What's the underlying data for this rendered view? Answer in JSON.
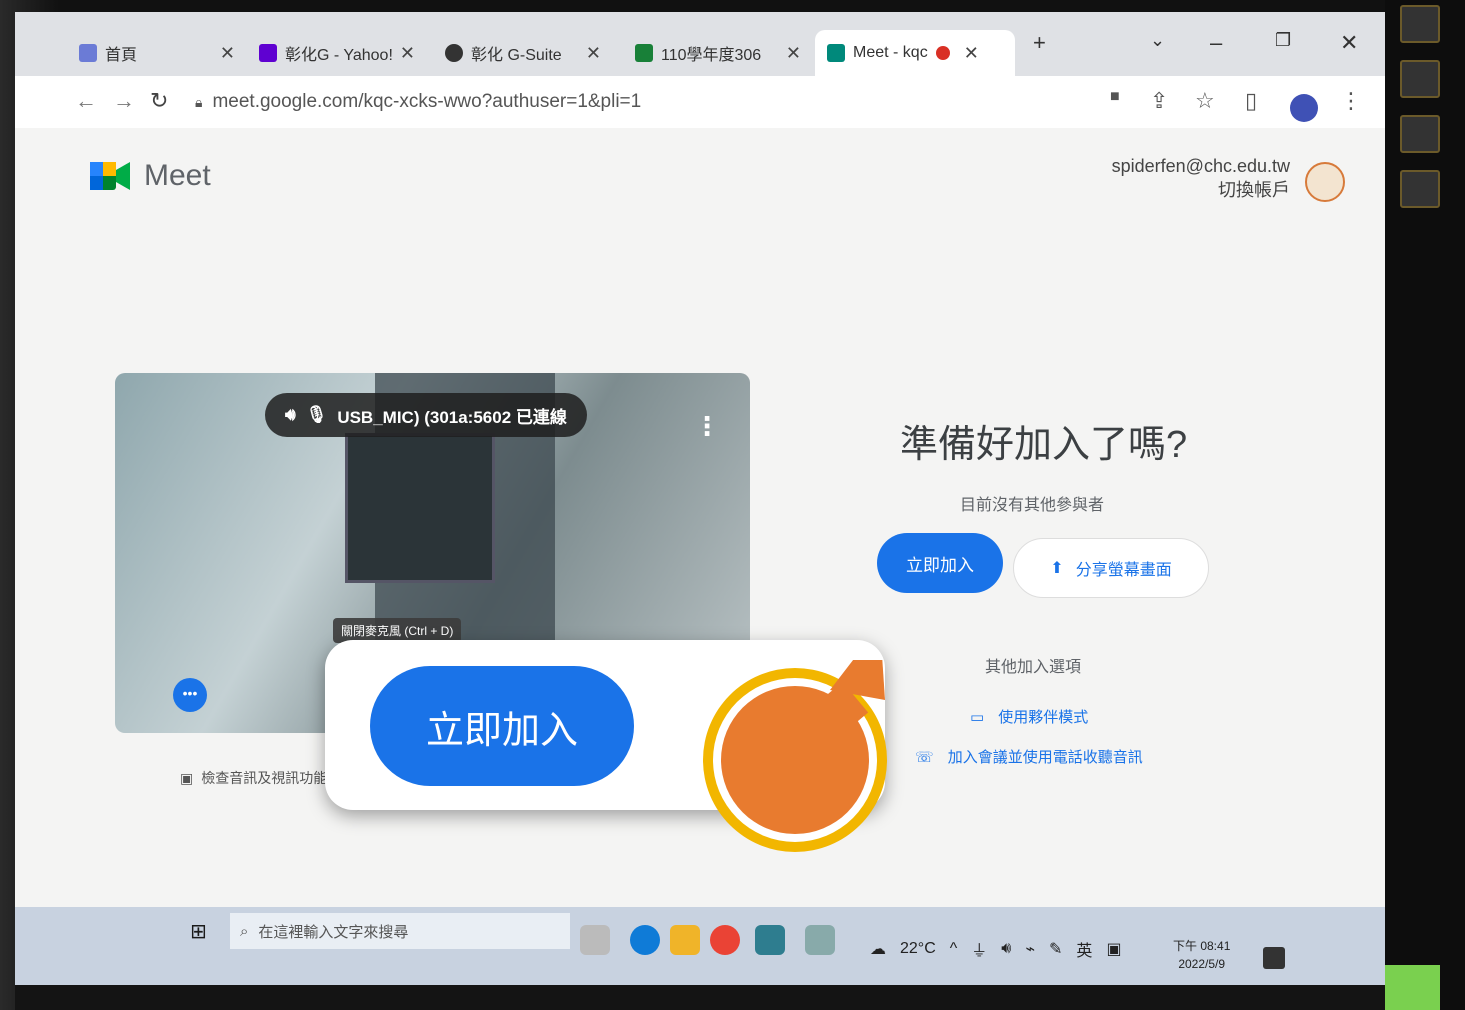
{
  "browser": {
    "tabs": [
      {
        "title": "首頁",
        "favicon": "#6b7bd6"
      },
      {
        "title": "彰化G - Yahoo!",
        "favicon": "#5f01d1"
      },
      {
        "title": "彰化 G-Suite",
        "favicon": "#333333"
      },
      {
        "title": "110學年度306",
        "favicon": "#188038"
      },
      {
        "title": "Meet - kqc",
        "favicon": "#00897b"
      }
    ],
    "new_tab_label": "+",
    "url": "meet.google.com/kqc-xcks-wwo?authuser=1&pli=1"
  },
  "meet": {
    "logo_text": "Meet",
    "account_email": "spiderfen@chc.edu.tw",
    "switch_account": "切換帳戶",
    "mic_label": "USB_MIC) (301a:5602 已連線",
    "tooltip": "關閉麥克風 (Ctrl + D)",
    "check_av": "檢查音訊及視訊功能",
    "ready_title": "準備好加入了嗎?",
    "no_others": "目前沒有其他參與者",
    "join_now": "立即加入",
    "present": "分享螢幕畫面",
    "other_options": "其他加入選項",
    "companion_mode": "使用夥伴模式",
    "phone_audio": "加入會議並使用電話收聽音訊"
  },
  "callout": {
    "big_join_label": "立即加入",
    "accent": "#e87b2f",
    "ring": "#f2b600"
  },
  "taskbar": {
    "search_placeholder": "在這裡輸入文字來搜尋",
    "weather": "22°C",
    "ime": "英",
    "time": "下午 08:41",
    "date": "2022/5/9"
  }
}
